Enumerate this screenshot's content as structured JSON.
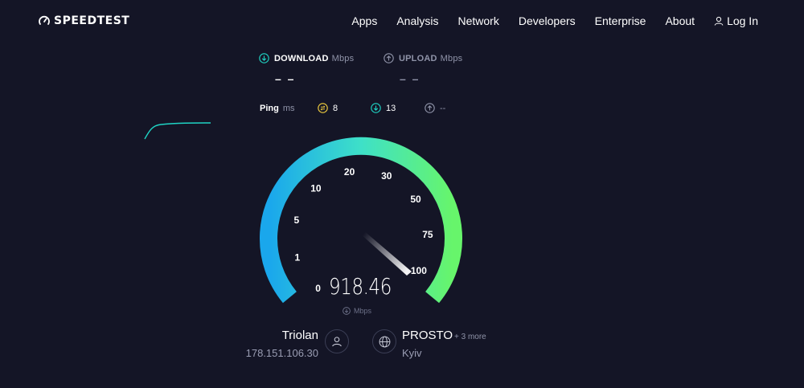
{
  "header": {
    "logo_text": "SPEEDTEST",
    "nav": [
      "Apps",
      "Analysis",
      "Network",
      "Developers",
      "Enterprise",
      "About"
    ],
    "login_label": "Log In"
  },
  "results": {
    "download": {
      "label": "DOWNLOAD",
      "unit": "Mbps",
      "value": "– –"
    },
    "upload": {
      "label": "UPLOAD",
      "unit": "Mbps",
      "value": "– –"
    }
  },
  "ping": {
    "label": "Ping",
    "unit": "ms",
    "idle": "8",
    "download": "13",
    "upload": "--"
  },
  "gauge": {
    "ticks": [
      "0",
      "1",
      "5",
      "10",
      "20",
      "30",
      "50",
      "75",
      "100"
    ],
    "current_value": "918.46",
    "unit": "Mbps",
    "fraction": 1.0
  },
  "provider": {
    "isp_name": "Triolan",
    "ip": "178.151.106.30"
  },
  "server": {
    "name": "PROSTO",
    "more": "+ 3 more",
    "location": "Kyiv"
  },
  "colors": {
    "background": "#141526",
    "accent_cyan": "#1fd4c4",
    "gauge_start": "#1aa7ec",
    "gauge_end": "#67f56b",
    "ping_idle": "#f4d03f"
  }
}
